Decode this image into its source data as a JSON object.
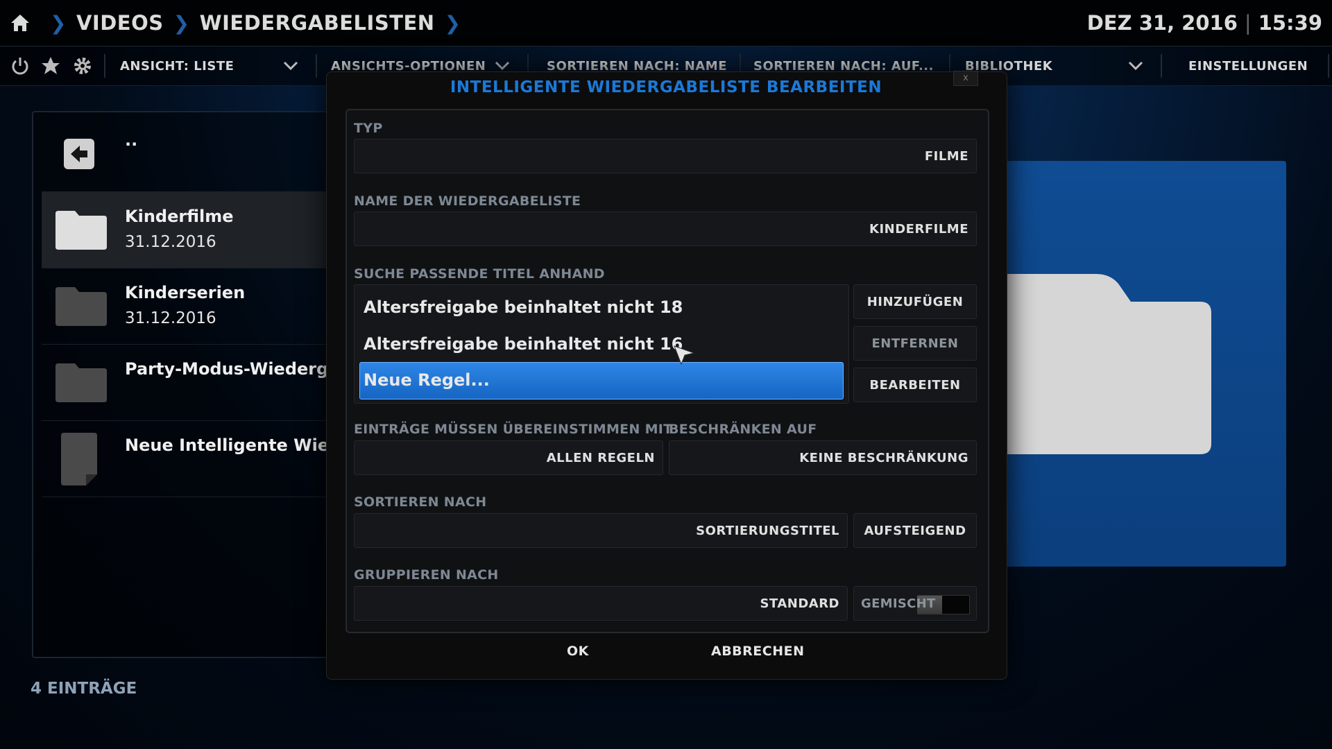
{
  "header": {
    "breadcrumbs": [
      "VIDEOS",
      "WIEDERGABELISTEN"
    ],
    "date": "DEZ 31, 2016",
    "time": "15:39"
  },
  "toolbar": {
    "view": "ANSICHT: LISTE",
    "view_options": "ANSICHTS-OPTIONEN",
    "sort_by": "SORTIEREN NACH: NAME",
    "sort_order": "SORTIEREN NACH: AUF...",
    "library": "BIBLIOTHEK",
    "settings": "EINSTELLUNGEN"
  },
  "list": {
    "parent": "..",
    "items": [
      {
        "title": "Kinderfilme",
        "date": "31.12.2016",
        "icon": "folder-icon"
      },
      {
        "title": "Kinderserien",
        "date": "31.12.2016",
        "icon": "folder-icon"
      },
      {
        "title": "Party-Modus-Wiedergabeliste",
        "date": "",
        "icon": "folder-icon"
      },
      {
        "title": "Neue Intelligente Wiedergabeliste...",
        "date": "",
        "icon": "file-icon"
      }
    ],
    "count": "4 EINTRÄGE"
  },
  "dialog": {
    "title": "INTELLIGENTE WIEDERGABELISTE BEARBEITEN",
    "close": "x",
    "type_label": "TYP",
    "type_value": "FILME",
    "name_label": "NAME DER WIEDERGABELISTE",
    "name_value": "KINDERFILME",
    "rules_label": "SUCHE PASSENDE TITEL ANHAND",
    "rules": [
      "Altersfreigabe beinhaltet nicht 18",
      "Altersfreigabe beinhaltet nicht 16",
      "Neue Regel..."
    ],
    "add_button": "HINZUFÜGEN",
    "remove_button": "ENTFERNEN",
    "edit_button": "BEARBEITEN",
    "match_label": "EINTRÄGE MÜSSEN ÜBEREINSTIMMEN MIT",
    "match_value": "ALLEN REGELN",
    "limit_label": "BESCHRÄNKEN AUF",
    "limit_value": "KEINE BESCHRÄNKUNG",
    "sort_label": "SORTIEREN NACH",
    "sort_value": "SORTIERUNGSTITEL",
    "sort_dir": "AUFSTEIGEND",
    "group_label": "GRUPPIEREN NACH",
    "group_value": "STANDARD",
    "mixed_label": "GEMISCHT",
    "ok": "OK",
    "cancel": "ABBRECHEN"
  },
  "colors": {
    "accent": "#1b79d8",
    "selection": "#1f6fd0",
    "preview": "#0f4c93"
  }
}
